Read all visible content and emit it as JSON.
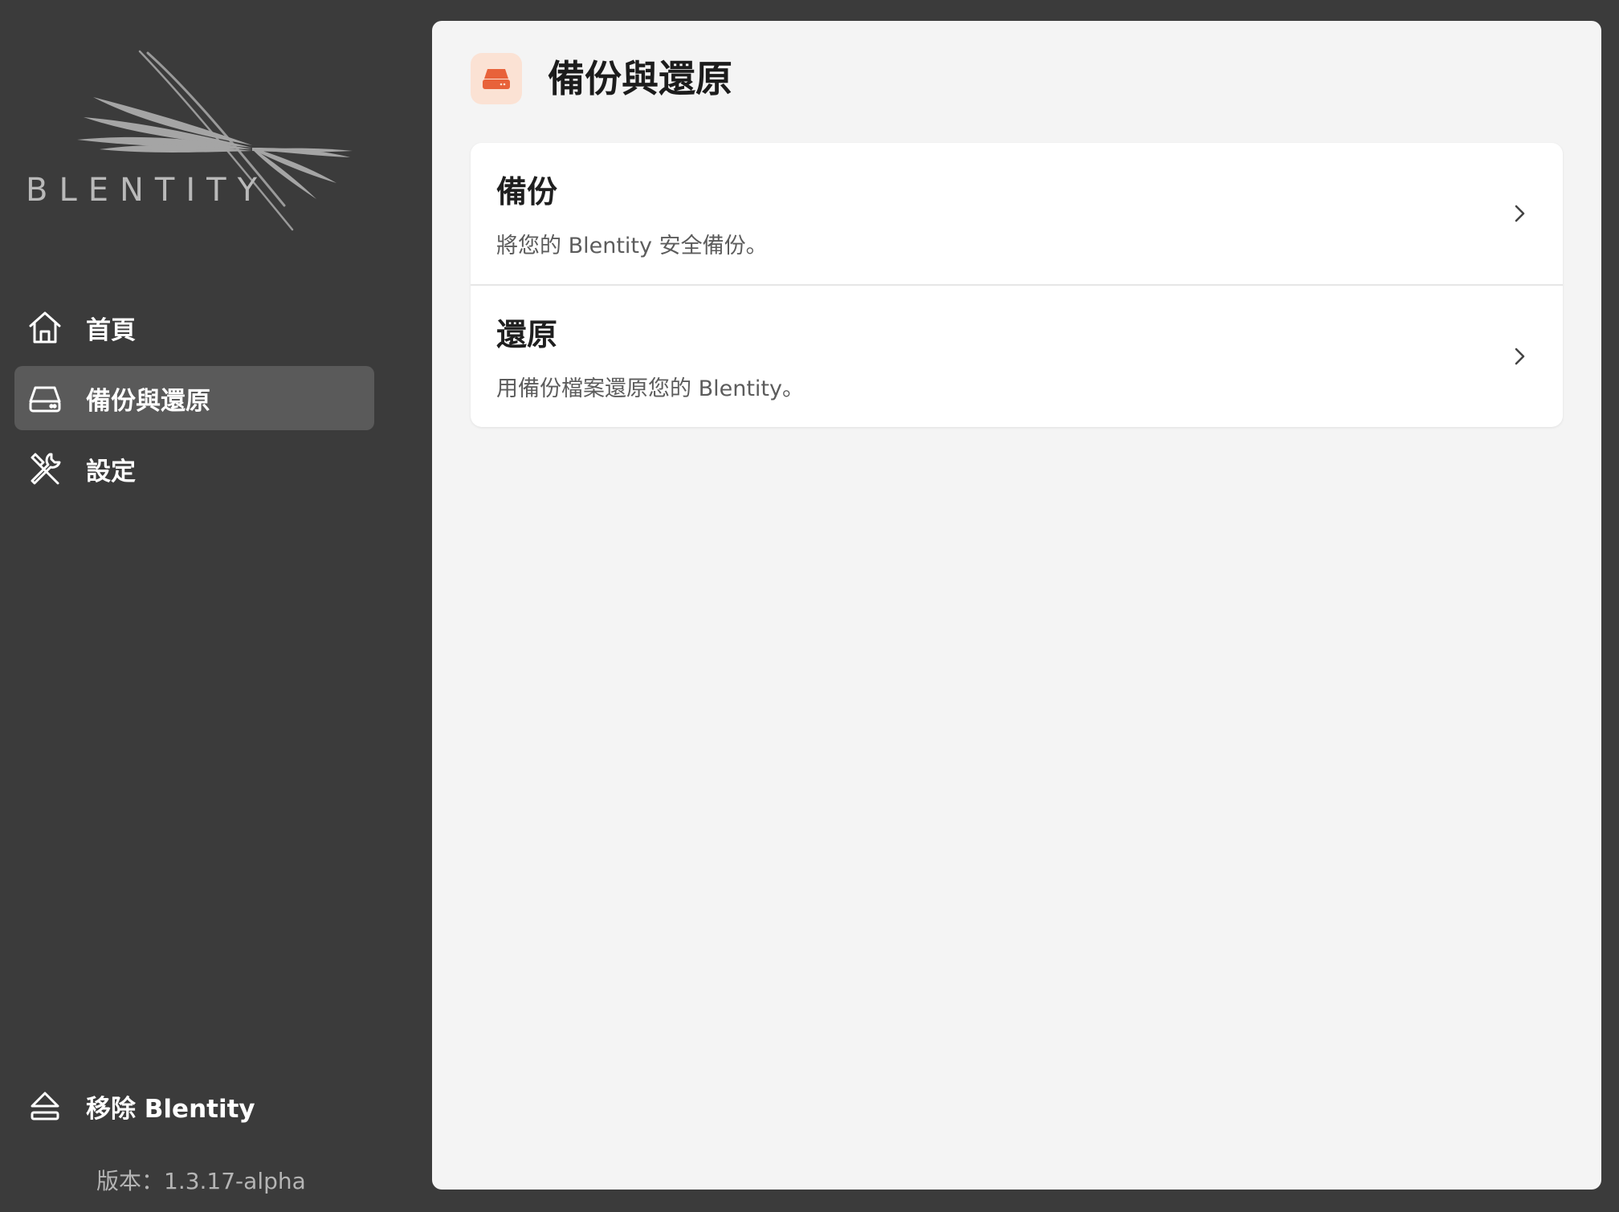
{
  "sidebar": {
    "logo_text": "BLENTITY",
    "items": [
      {
        "label": "首頁",
        "icon": "home-icon",
        "active": false
      },
      {
        "label": "備份與還原",
        "icon": "drive-icon",
        "active": true
      },
      {
        "label": "設定",
        "icon": "tools-icon",
        "active": false
      }
    ],
    "remove": {
      "label": "移除 Blentity",
      "icon": "eject-icon"
    },
    "version": "版本：1.3.17-alpha"
  },
  "main": {
    "title": "備份與還原",
    "header_icon": "drive-icon",
    "rows": [
      {
        "title": "備份",
        "description": "將您的 Blentity 安全備份。"
      },
      {
        "title": "還原",
        "description": "用備份檔案還原您的 Blentity。"
      }
    ]
  },
  "colors": {
    "sidebar_bg": "#3b3b3b",
    "active_item_bg": "#5a5a5a",
    "main_bg": "#f4f4f4",
    "accent": "#e8623a",
    "accent_soft": "#fbe2d4"
  }
}
